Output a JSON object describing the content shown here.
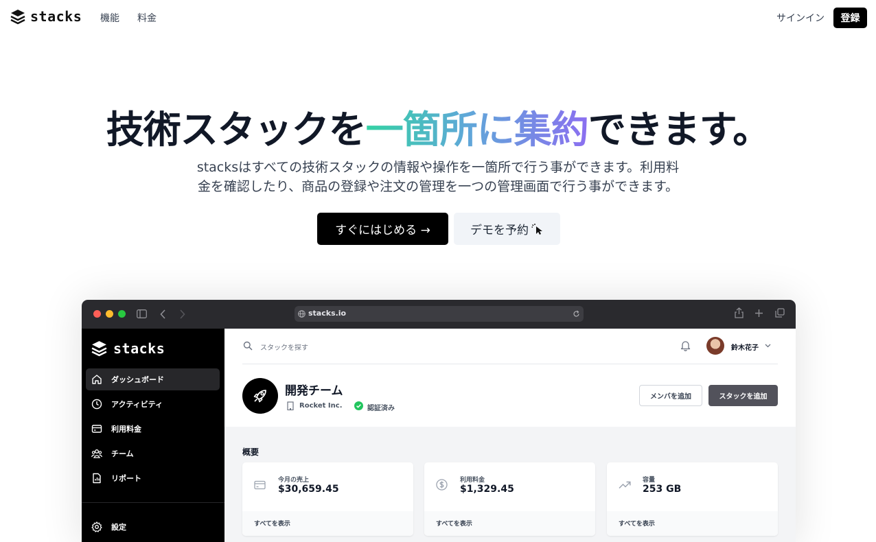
{
  "nav": {
    "logo_text": "stacks",
    "links": [
      "機能",
      "料金"
    ],
    "signin_label": "サインイン",
    "register_label": "登録"
  },
  "hero": {
    "title_part1": "技術スタックを",
    "title_highlight": "一箇所に集約",
    "title_part2": "できます。",
    "subtitle_line1": "stacksはすべての技術スタックの情報や操作を一箇所で行う事ができます。利用料",
    "subtitle_line2": "金を確認したり、商品の登録や注文の管理を一つの管理画面で行う事ができます。",
    "start_button": "すぐにはじめる →",
    "demo_button": "デモを予約"
  },
  "browser": {
    "url": "stacks.io"
  },
  "app": {
    "logo_text": "stacks",
    "sidebar": [
      {
        "label": "ダッシュボード",
        "icon": "home-icon",
        "active": true
      },
      {
        "label": "アクティビティ",
        "icon": "clock-icon",
        "active": false
      },
      {
        "label": "利用料金",
        "icon": "credit-card-icon",
        "active": false
      },
      {
        "label": "チーム",
        "icon": "users-icon",
        "active": false
      },
      {
        "label": "リポート",
        "icon": "report-icon",
        "active": false
      }
    ],
    "settings_label": "設定",
    "search_placeholder": "スタックを探す",
    "user_name": "鈴木花子",
    "team": {
      "name": "開発チーム",
      "company": "Rocket Inc.",
      "verified": "認証済み"
    },
    "add_member_button": "メンバを追加",
    "add_stack_button": "スタックを追加",
    "overview_title": "概要",
    "cards": [
      {
        "label": "今月の売上",
        "value": "$30,659.45",
        "footer": "すべてを表示",
        "icon": "credit-card-icon"
      },
      {
        "label": "利用料金",
        "value": "$1,329.45",
        "footer": "すべてを表示",
        "icon": "dollar-icon"
      },
      {
        "label": "容量",
        "value": "253 GB",
        "footer": "すべてを表示",
        "icon": "trending-up-icon"
      }
    ]
  },
  "colors": {
    "gradient_start": "#34d2a4",
    "gradient_end": "#8b6ff0",
    "sidebar_bg": "#000000",
    "primary_button": "#000000",
    "verified_green": "#22c55e"
  }
}
